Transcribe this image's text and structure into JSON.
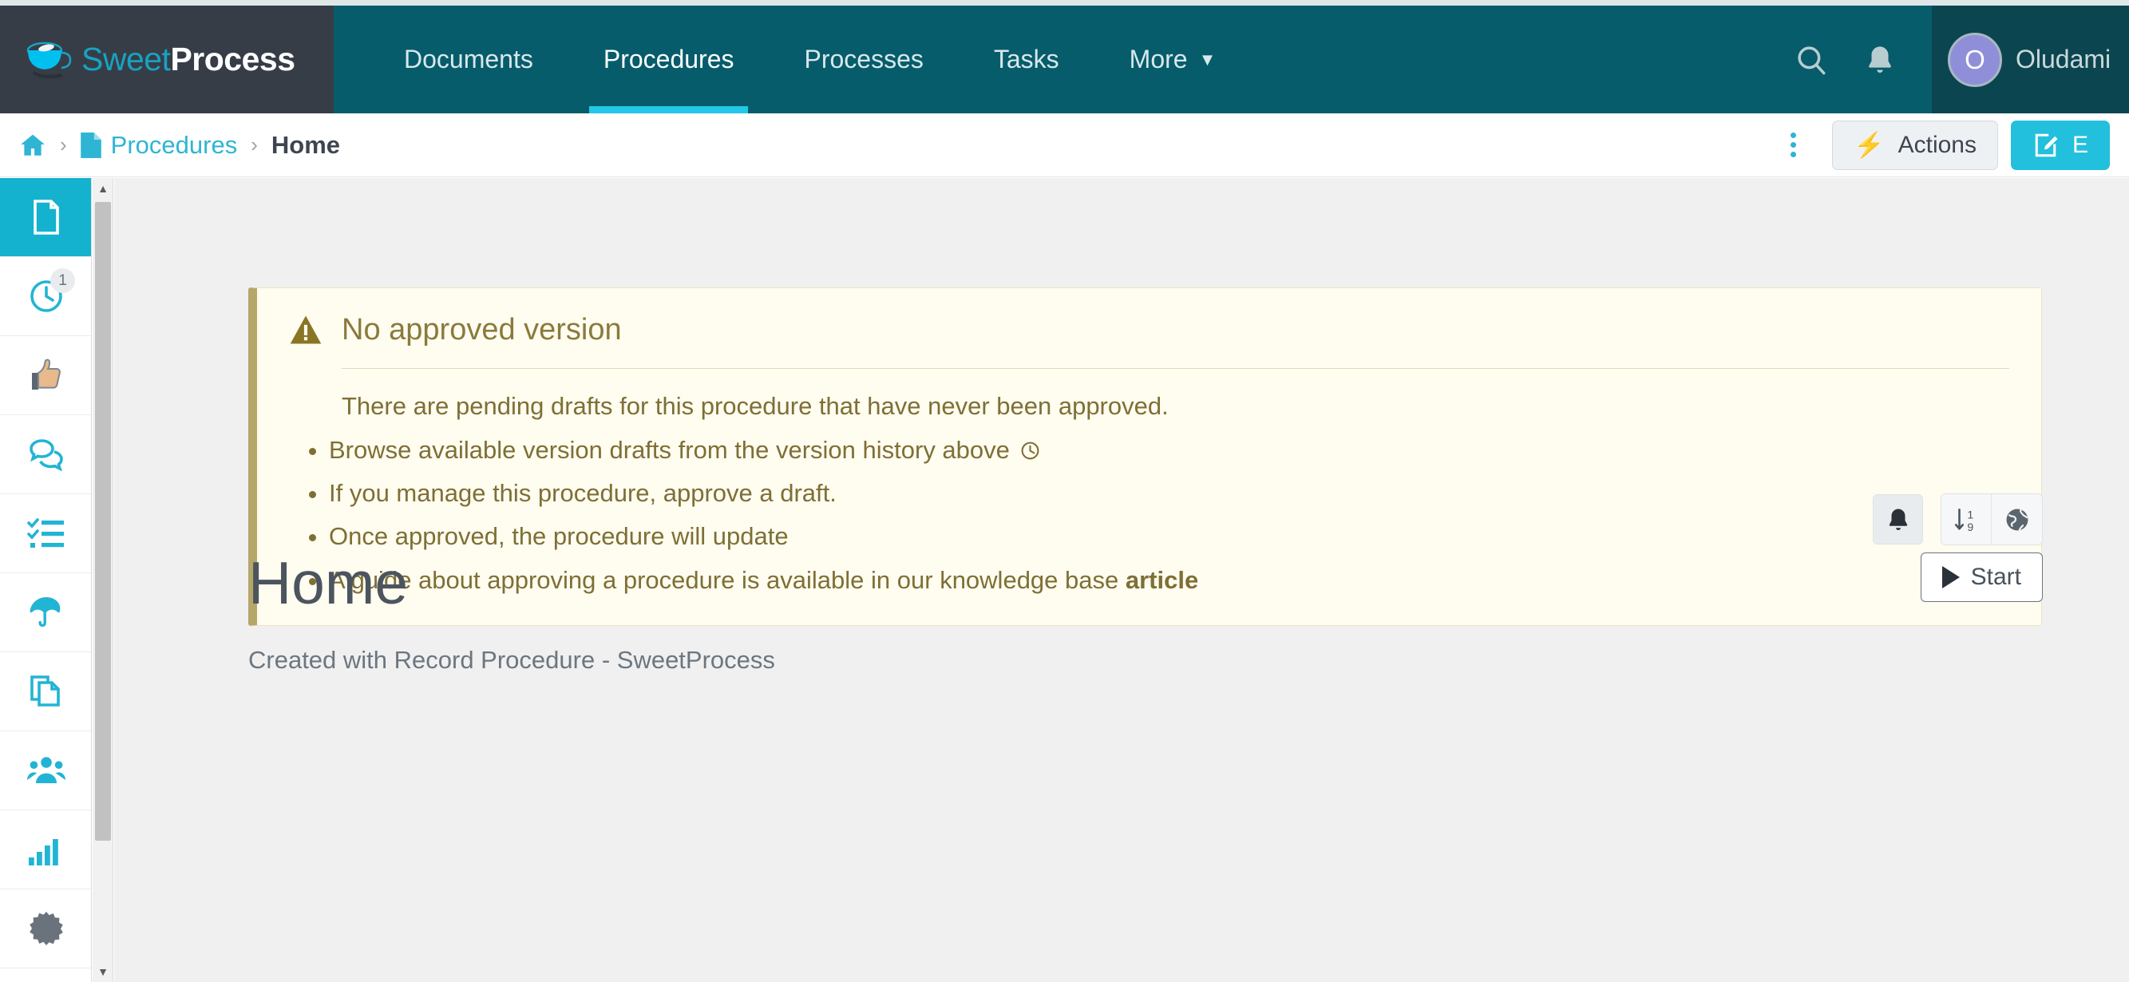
{
  "brand": {
    "name_part1": "Sweet",
    "name_part2": "Process",
    "logo_icon": "coffee-cup-icon"
  },
  "topnav": {
    "items": [
      {
        "label": "Documents",
        "active": false
      },
      {
        "label": "Procedures",
        "active": true
      },
      {
        "label": "Processes",
        "active": false
      },
      {
        "label": "Tasks",
        "active": false
      },
      {
        "label": "More",
        "active": false,
        "has_chevron": true
      }
    ],
    "search_icon": "search-icon",
    "notifications_icon": "bell-icon",
    "user": {
      "initial": "O",
      "name": "Oludami"
    }
  },
  "breadcrumb": {
    "home_icon": "home-icon",
    "separator": "›",
    "doc_icon": "document-icon",
    "parent_label": "Procedures",
    "current_label": "Home"
  },
  "toolbar": {
    "kebab_icon": "more-vertical-icon",
    "actions_label": "Actions",
    "actions_icon": "lightning-bolt-icon",
    "edit_icon": "edit-pencil-icon",
    "edit_label": "E"
  },
  "sidebar": {
    "items": [
      {
        "name": "document",
        "icon": "document-icon",
        "active": true,
        "badge": null
      },
      {
        "name": "version-history",
        "icon": "clock-icon",
        "active": false,
        "badge": "1"
      },
      {
        "name": "approvals",
        "icon": "thumbs-up-icon",
        "active": false,
        "badge": null
      },
      {
        "name": "comments",
        "icon": "chat-bubbles-icon",
        "active": false,
        "badge": null
      },
      {
        "name": "tasks",
        "icon": "checklist-icon",
        "active": false,
        "badge": null
      },
      {
        "name": "policies",
        "icon": "umbrella-icon",
        "active": false,
        "badge": null
      },
      {
        "name": "duplicate",
        "icon": "copy-icon",
        "active": false,
        "badge": null
      },
      {
        "name": "teams",
        "icon": "users-icon",
        "active": false,
        "badge": null
      },
      {
        "name": "reports",
        "icon": "bar-chart-icon",
        "active": false,
        "badge": null
      },
      {
        "name": "settings",
        "icon": "gear-icon",
        "active": false,
        "badge": null
      }
    ],
    "scrollbar": {
      "up_arrow": "▲",
      "down_arrow": "▼"
    }
  },
  "alert": {
    "icon": "warning-triangle-icon",
    "title": "No approved version",
    "intro": "There are pending drafts for this procedure that have never been approved.",
    "bullets": [
      {
        "text": "Browse available version drafts from the version history above",
        "trailing_icon": "clock-icon"
      },
      {
        "text": "If you manage this procedure, approve a draft.",
        "trailing_icon": null
      },
      {
        "text": "Once approved, the procedure will update",
        "trailing_icon": null
      },
      {
        "text": "A guide about approving a procedure is available in our knowledge base ",
        "bold_suffix": "article",
        "trailing_icon": null
      }
    ]
  },
  "document": {
    "title": "Home",
    "subtitle": "Created with Record Procedure - SweetProcess",
    "actions": [
      {
        "name": "subscribe",
        "icon": "bell-icon"
      },
      {
        "name": "sort-order",
        "icon": "sort-numeric-icon"
      },
      {
        "name": "visibility",
        "icon": "globe-icon"
      }
    ],
    "start_label": "Start",
    "start_icon": "play-icon"
  },
  "colors": {
    "nav_teal": "#065c6b",
    "logo_dark": "#373d47",
    "user_teal": "#0b4650",
    "accent_cyan": "#22c8e8",
    "link_cyan": "#2eb5d4",
    "alert_bg": "#fffcf0",
    "alert_border": "#b5a66a",
    "alert_text": "#7e6f35",
    "content_bg": "#f0f0f0",
    "avatar_purple": "#8f8fd9"
  }
}
